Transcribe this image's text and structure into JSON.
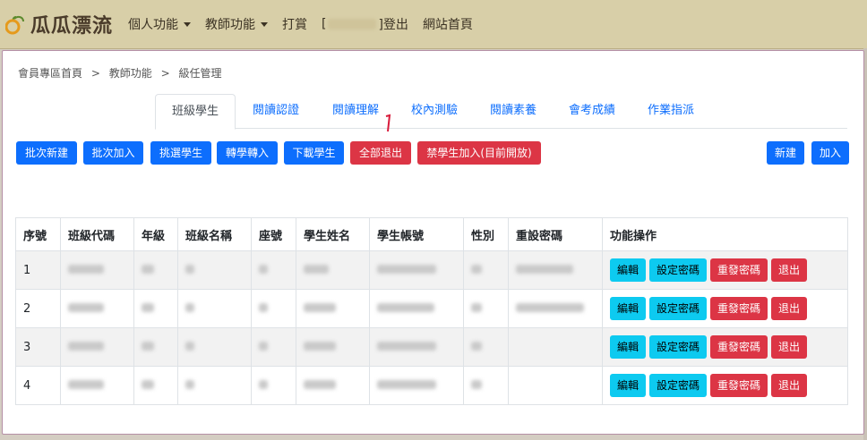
{
  "brand": {
    "name": "瓜瓜漂流"
  },
  "nav": {
    "personal": "個人功能",
    "teacher": "教師功能",
    "reward": "打賞",
    "user_open": "[",
    "user_close": "]登出",
    "home": "網站首頁"
  },
  "breadcrumb": {
    "home": "會員專區首頁",
    "sep": ">",
    "teacher": "教師功能",
    "current": "級任管理"
  },
  "tabs": [
    "班級學生",
    "閱讀認證",
    "閱讀理解",
    "校內測驗",
    "閱讀素養",
    "會考成績",
    "作業指派"
  ],
  "actions": {
    "batch_create": "批次新建",
    "batch_add": "批次加入",
    "pick": "挑選學生",
    "transfer": "轉學轉入",
    "download": "下載學生",
    "exit_all": "全部退出",
    "ban_join": "禁學生加入(目前開放)",
    "create": "新建",
    "add": "加入"
  },
  "table": {
    "headers": [
      "序號",
      "班級代碼",
      "年級",
      "班級名稱",
      "座號",
      "學生姓名",
      "學生帳號",
      "性別",
      "重設密碼",
      "功能操作"
    ],
    "rows": [
      {
        "no": "1"
      },
      {
        "no": "2"
      },
      {
        "no": "3"
      },
      {
        "no": "4"
      }
    ],
    "ops": {
      "edit": "編輯",
      "set_pw": "設定密碼",
      "resend_pw": "重發密碼",
      "exit": "退出"
    }
  },
  "colors": {
    "primary": "#0d6efd",
    "danger": "#dc3545",
    "info": "#0dcaf0",
    "topbar": "#d8cfa8"
  }
}
